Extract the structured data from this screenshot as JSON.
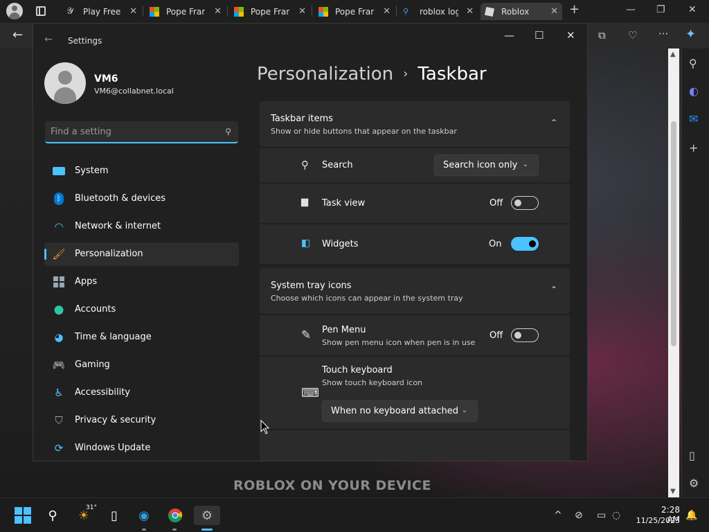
{
  "browser": {
    "tabs": [
      {
        "title": "Play Free G",
        "icon": "sword-icon"
      },
      {
        "title": "Pope Franc",
        "icon": "microsoft-icon"
      },
      {
        "title": "Pope Franc",
        "icon": "microsoft-icon"
      },
      {
        "title": "Pope Franc",
        "icon": "microsoft-icon"
      },
      {
        "title": "roblox log",
        "icon": "search-icon"
      },
      {
        "title": "Roblox",
        "icon": "roblox-icon"
      }
    ],
    "close_glyph": "✕",
    "new_tab_glyph": "+",
    "window_controls": {
      "minimize": "—",
      "maximize": "❐",
      "close": "✕"
    },
    "toolbar": {
      "back": "←",
      "more": "···"
    },
    "banner": "ROBLOX ON YOUR DEVICE"
  },
  "settings": {
    "window_title": "Settings",
    "back_glyph": "←",
    "window_controls": {
      "minimize": "—",
      "maximize": "☐",
      "close": "✕"
    },
    "user": {
      "name": "VM6",
      "email": "VM6@collabnet.local"
    },
    "search": {
      "placeholder": "Find a setting",
      "value": ""
    },
    "nav": [
      {
        "label": "System",
        "icon": "monitor-icon",
        "color": "#4cc2ff"
      },
      {
        "label": "Bluetooth & devices",
        "icon": "bluetooth-icon",
        "color": "#0078d4"
      },
      {
        "label": "Network & internet",
        "icon": "wifi-icon",
        "color": "#4cc2ff"
      },
      {
        "label": "Personalization",
        "icon": "brush-icon",
        "color": "#f0a030",
        "selected": true
      },
      {
        "label": "Apps",
        "icon": "apps-icon",
        "color": "#9aa6b2"
      },
      {
        "label": "Accounts",
        "icon": "person-icon",
        "color": "#2ec5a4"
      },
      {
        "label": "Time & language",
        "icon": "globe-clock-icon",
        "color": "#4cc2ff"
      },
      {
        "label": "Gaming",
        "icon": "gamepad-icon",
        "color": "#b0b0b0"
      },
      {
        "label": "Accessibility",
        "icon": "accessibility-icon",
        "color": "#4cc2ff"
      },
      {
        "label": "Privacy & security",
        "icon": "shield-icon",
        "color": "#9aa6b2"
      },
      {
        "label": "Windows Update",
        "icon": "update-icon",
        "color": "#4cc2ff"
      }
    ],
    "breadcrumb": {
      "parent": "Personalization",
      "separator": "›",
      "current": "Taskbar"
    },
    "taskbar_items": {
      "title": "Taskbar items",
      "subtitle": "Show or hide buttons that appear on the taskbar",
      "chevron": "⌃",
      "search": {
        "label": "Search",
        "value": "Search icon only",
        "chevron": "⌄"
      },
      "task_view": {
        "label": "Task view",
        "state": "Off"
      },
      "widgets": {
        "label": "Widgets",
        "state": "On"
      }
    },
    "system_tray": {
      "title": "System tray icons",
      "subtitle": "Choose which icons can appear in the system tray",
      "chevron": "⌃",
      "pen_menu": {
        "label": "Pen Menu",
        "sub": "Show pen menu icon when pen is in use",
        "state": "Off"
      },
      "touch_keyboard": {
        "label": "Touch keyboard",
        "sub": "Show touch keyboard icon",
        "value": "When no keyboard attached",
        "chevron": "⌄"
      }
    }
  },
  "taskbar": {
    "weather_temp": "31°",
    "time": "2:28 AM",
    "date": "11/25/2023",
    "tray_chevron": "^"
  }
}
